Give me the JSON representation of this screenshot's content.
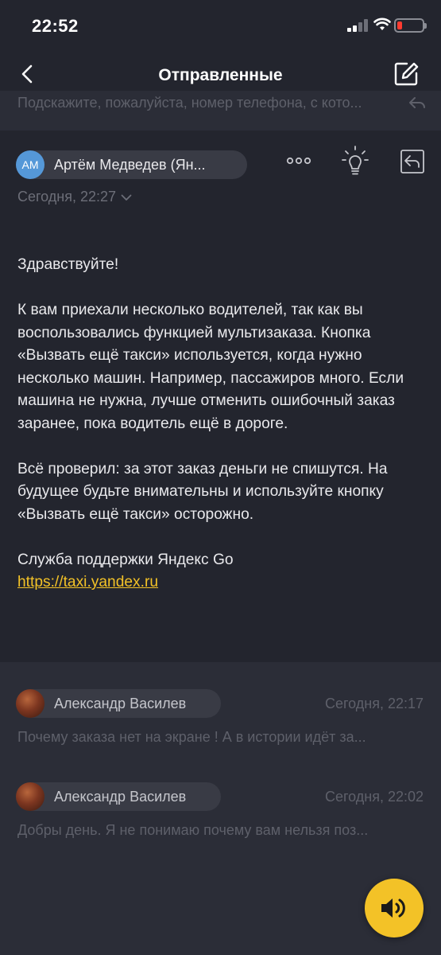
{
  "status_bar": {
    "time": "22:52",
    "battery_color": "#ff3b30"
  },
  "nav": {
    "title": "Отправленные",
    "back_icon": "chevron-left-icon",
    "compose_icon": "compose-icon"
  },
  "previous_message": {
    "snippet": "Подскажите, пожалуйста, номер телефона, с кото..."
  },
  "message": {
    "sender_initials": "АМ",
    "sender_name": "Артём Медведев (Ян...",
    "date": "Сегодня, 22:27",
    "body": {
      "greeting": "Здравствуйте!",
      "paragraph1": "К вам приехали несколько водителей, так как вы воспользовались функцией мультизаказа. Кнопка «Вызвать ещё такси» используется, когда нужно несколько машин. Например, пассажиров много. Если машина не нужна, лучше отменить ошибочный заказ заранее, пока водитель ещё в дороге.",
      "paragraph2": "Всё проверил: за этот заказ деньги не спишутся. На будущее будьте внимательны и используйте кнопку «Вызвать ещё такси» осторожно.",
      "signature": "Служба поддержки Яндекс Go",
      "link": "https://taxi.yandex.ru"
    },
    "link_color": "#f3c227",
    "avatar_color": "#5598d8"
  },
  "threads": [
    {
      "sender": "Александр Василев",
      "date": "Сегодня, 22:17",
      "snippet": "Почему заказа нет на экране ! А в истории идёт за..."
    },
    {
      "sender": "Александр Василев",
      "date": "Сегодня, 22:02",
      "snippet": "Добры день. Я не понимаю почему вам нельзя поз..."
    }
  ],
  "voice_button": {
    "icon": "speaker-icon",
    "color": "#f3c227"
  }
}
